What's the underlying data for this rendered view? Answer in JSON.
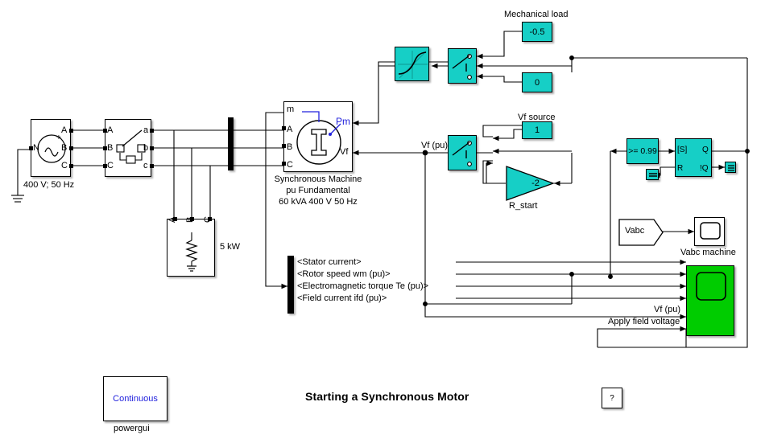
{
  "page": {
    "title": "Starting a Synchronous Motor",
    "help_label": "?"
  },
  "source": {
    "caption": "400 V; 50 Hz",
    "ports": {
      "n": "N",
      "a": "A",
      "b": "B",
      "c": "C"
    },
    "plus": "+"
  },
  "breaker": {
    "in": {
      "a": "A",
      "b": "B",
      "c": "C"
    },
    "out": {
      "a": "a",
      "b": "b",
      "c": "c"
    }
  },
  "load": {
    "caption": "5 kW",
    "ports": {
      "a": "A",
      "b": "B",
      "c": "C"
    }
  },
  "machine": {
    "caption_line1": "Synchronous Machine",
    "caption_line2": "pu Fundamental",
    "caption_line3": "60 kVA  400 V 50 Hz",
    "ports": {
      "m": "m",
      "a": "A",
      "b": "B",
      "c": "C",
      "pm": "Pm",
      "vf": "Vf"
    }
  },
  "bus_selector": {
    "signals": [
      "<Stator current>",
      "<Rotor speed  wm (pu)>",
      "<Electromagnetic torque  Te (pu)>",
      "<Field current  ifd (pu)>"
    ]
  },
  "mech": {
    "group_label": "Mechanical load",
    "const_load": "-0.5",
    "const_zero": "0"
  },
  "vf": {
    "signal_label": "Vf (pu)",
    "source_label": "Vf source",
    "source_value": "1",
    "gain_value": "-2",
    "gain_label": "R_start"
  },
  "logic": {
    "compare_label": ">= 0.99",
    "flipflop": {
      "s": "[S]",
      "q": "Q",
      "r": "R",
      "nq": "!Q"
    }
  },
  "scopes": {
    "vabc_from": "Vabc",
    "vabc_scope_label": "Vabc machine",
    "main_scope_inputs": [
      "Vf (pu)",
      "Apply field voltage"
    ]
  },
  "powergui": {
    "text": "Continuous",
    "caption": "powergui"
  },
  "colors": {
    "block_cyan": "#16cfc6",
    "scope_green": "#00cc00",
    "signal_blue": "#2222dd",
    "wire": "#000000"
  }
}
